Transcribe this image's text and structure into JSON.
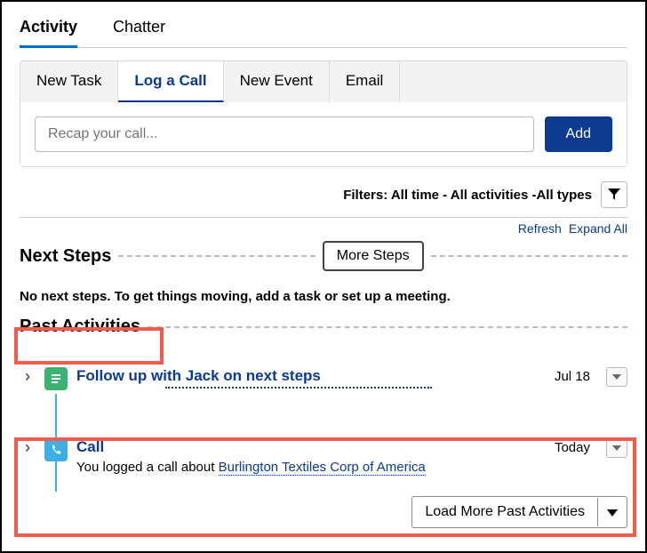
{
  "topTabs": {
    "activity": "Activity",
    "chatter": "Chatter"
  },
  "activityTabs": {
    "newTask": "New Task",
    "logCall": "Log a Call",
    "newEvent": "New Event",
    "email": "Email"
  },
  "callInput": {
    "placeholder": "Recap your call..."
  },
  "addButton": "Add",
  "filtersLabel": "Filters: All time - All activities -All types",
  "links": {
    "refresh": "Refresh",
    "expandAll": "Expand All"
  },
  "nextSteps": {
    "title": "Next Steps",
    "moreBtn": "More Steps",
    "empty": "No next steps. To get things moving, add a task or set up a meeting."
  },
  "pastActivities": {
    "title": "Past Activities",
    "items": [
      {
        "title": "Follow up with Jack on next steps",
        "date": "Jul 18"
      },
      {
        "title": "Call",
        "subPrefix": "You logged a call about ",
        "subLink": "Burlington Textiles Corp of America",
        "date": "Today"
      }
    ],
    "loadMore": "Load More Past Activities"
  }
}
